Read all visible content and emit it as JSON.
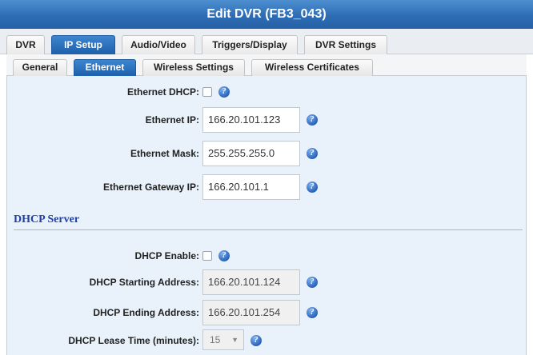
{
  "window": {
    "title": "Edit DVR (FB3_043)"
  },
  "main_tabs": [
    "DVR",
    "IP Setup",
    "Audio/Video",
    "Triggers/Display",
    "DVR Settings"
  ],
  "sub_tabs": [
    "General",
    "Ethernet",
    "Wireless Settings",
    "Wireless Certificates"
  ],
  "ethernet": {
    "dhcp_label": "Ethernet DHCP:",
    "ip_label": "Ethernet IP:",
    "ip_value": "166.20.101.123",
    "mask_label": "Ethernet Mask:",
    "mask_value": "255.255.255.0",
    "gateway_label": "Ethernet Gateway IP:",
    "gateway_value": "166.20.101.1"
  },
  "dhcp_server": {
    "title": "DHCP Server",
    "enable_label": "DHCP Enable:",
    "start_label": "DHCP Starting Address:",
    "start_value": "166.20.101.124",
    "end_label": "DHCP Ending Address:",
    "end_value": "166.20.101.254",
    "lease_label": "DHCP Lease Time (minutes):",
    "lease_value": "15"
  },
  "icons": {
    "help": "help-question-icon",
    "dropdown": "chevron-down-icon"
  },
  "colors": {
    "accent": "#2e6db4",
    "panel_bg": "#e9f2fb",
    "section_title": "#1f3fa8"
  }
}
